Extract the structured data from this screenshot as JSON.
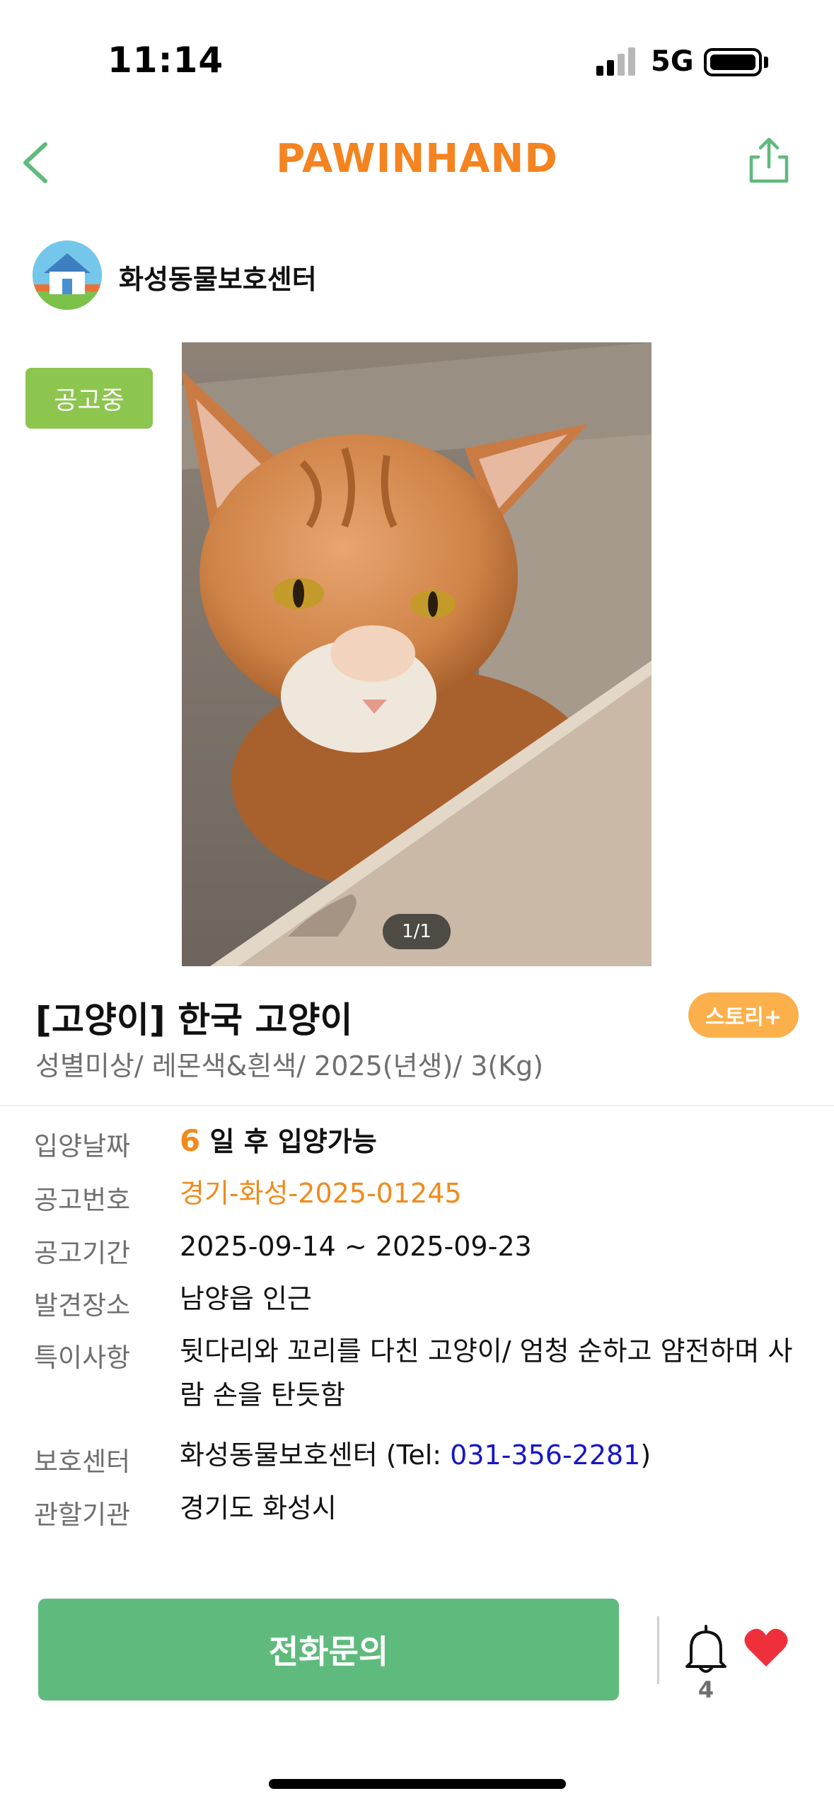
{
  "status_bar": {
    "time": "11:14",
    "network": "5G"
  },
  "header": {
    "logo": "PAWINHAND"
  },
  "shelter": {
    "name": "화성동물보호센터"
  },
  "photo": {
    "status_badge": "공고중",
    "counter": "1/1"
  },
  "pet": {
    "title": "[고양이] 한국 고양이",
    "story_button": "스토리+",
    "summary": "성별미상/ 레몬색&흰색/ 2025(년생)/ 3(Kg)"
  },
  "info": {
    "adopt_date": {
      "label": "입양날짜",
      "days": "6",
      "suffix": " 일 후 입양가능"
    },
    "notice_number": {
      "label": "공고번호",
      "value": "경기-화성-2025-01245"
    },
    "notice_period": {
      "label": "공고기간",
      "value": "2025-09-14 ~ 2025-09-23"
    },
    "found_place": {
      "label": "발견장소",
      "value": "남양읍 인근"
    },
    "special_notes": {
      "label": "특이사항",
      "value": "뒷다리와 꼬리를 다친 고양이/ 엄청 순하고 얌전하며 사람 손을 탄듯함"
    },
    "shelter_center": {
      "label": "보호센터",
      "prefix": "화성동물보호센터 (Tel: ",
      "phone": "031-356-2281",
      "suffix": ")"
    },
    "jurisdiction": {
      "label": "관할기관",
      "value": "경기도 화성시"
    }
  },
  "actions": {
    "call_button": "전화문의",
    "bell_count": "4"
  },
  "colors": {
    "accent_orange": "#f5831f",
    "green": "#5fba7d",
    "badge_green": "#8cc64f",
    "story_orange": "#fcb04c",
    "link_blue": "#1616c8",
    "heart_red": "#ef2f3c"
  }
}
